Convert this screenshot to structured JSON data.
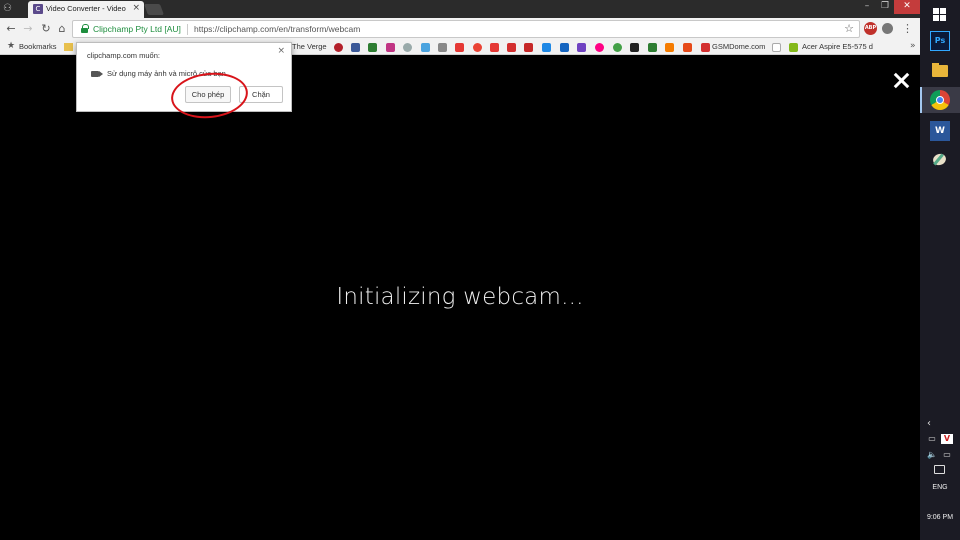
{
  "browser": {
    "tab_title": "Video Converter - Video",
    "tab_favicon_letter": "C",
    "tab_close": "×",
    "secure_label": "Clipchamp Pty Ltd [AU]",
    "url": "https://clipchamp.com/en/transform/webcam"
  },
  "bookmarks": {
    "label": "Bookmarks",
    "items": [
      {
        "text": "The Verge",
        "icon": "verge-icon"
      },
      {
        "text": "GSMDome.com",
        "icon": "gsmdome-icon"
      },
      {
        "text": "Acer Aspire E5-575 d",
        "icon": "acer-icon"
      }
    ]
  },
  "popup": {
    "origin": "clipchamp.com muốn:",
    "permission_text": "Sử dụng máy ảnh và micrô của bạn",
    "allow_label": "Cho phép",
    "block_label": "Chặn",
    "close": "×"
  },
  "page": {
    "status_message": "Initializing webcam..."
  },
  "taskbar": {
    "apps": [
      "windows-start",
      "photoshop",
      "file-explorer",
      "chrome",
      "word",
      "paint"
    ],
    "ps_label": "Ps",
    "word_label": "W",
    "tray_chevron": "‹",
    "tray_v_label": "V",
    "language": "ENG",
    "time": "9:06 PM"
  },
  "colors": {
    "secure_green": "#1e8e3e",
    "annotation_red": "#d8141a",
    "page_bg": "#000000",
    "taskbar_bg": "#1b1b24"
  }
}
